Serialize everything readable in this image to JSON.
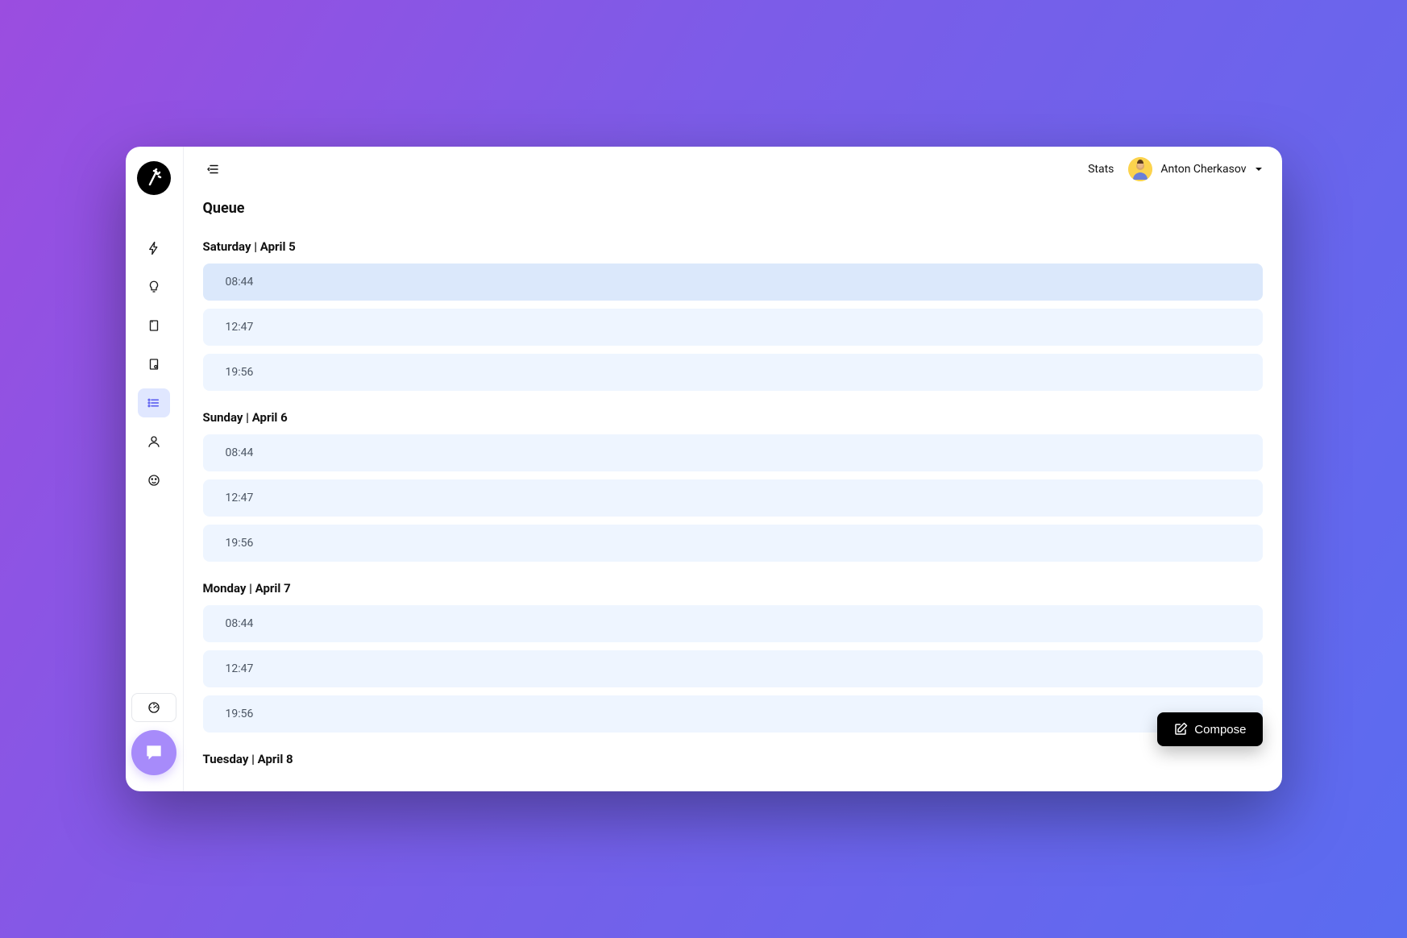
{
  "header": {
    "stats_label": "Stats",
    "user_name": "Anton Cherkasov"
  },
  "page": {
    "title": "Queue",
    "compose_label": "Compose",
    "days": [
      {
        "heading": "Saturday | April 5",
        "slots": [
          "08:44",
          "12:47",
          "19:56"
        ],
        "highlight_first": true
      },
      {
        "heading": "Sunday | April 6",
        "slots": [
          "08:44",
          "12:47",
          "19:56"
        ],
        "highlight_first": false
      },
      {
        "heading": "Monday | April 7",
        "slots": [
          "08:44",
          "12:47",
          "19:56"
        ],
        "highlight_first": false
      },
      {
        "heading": "Tuesday | April 8",
        "slots": [],
        "highlight_first": false
      }
    ]
  },
  "sidebar": {
    "icons": [
      "lightning-icon",
      "bulb-icon",
      "note-icon",
      "bookmark-icon",
      "list-icon",
      "person-icon",
      "face-icon"
    ],
    "active_index": 4
  }
}
